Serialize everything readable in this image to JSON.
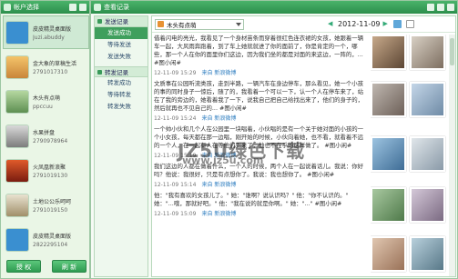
{
  "left_window": {
    "title": "帐户选择",
    "accounts": [
      {
        "name": "皮皮精灵桌面版",
        "id": "Juzi.abuddy"
      },
      {
        "name": "金大象的草稿生活",
        "id": "2791017310"
      },
      {
        "name": "木头有点萌",
        "id": "ppccuu"
      },
      {
        "name": "水果拼盘",
        "id": "2790978964"
      },
      {
        "name": "火凤凰新浪聚",
        "id": "2791019130"
      },
      {
        "name": "土地公公乐呵呵",
        "id": "2791019150"
      },
      {
        "name": "皮皮精灵桌面版",
        "id": "2822295104"
      }
    ],
    "buttons": {
      "authorize": "授 权",
      "refresh": "刷 新"
    }
  },
  "right_window": {
    "title": "查看记录",
    "nav": {
      "section1": "发送记录",
      "section1_items": [
        "发送成功",
        "等待发送",
        "发送失败"
      ],
      "section2": "转发记录",
      "section2_items": [
        "转发成功",
        "等待转发",
        "转发失败"
      ]
    },
    "toolbar": {
      "account_selected": "木头有点萌",
      "date": "2012-11-09"
    },
    "entries": [
      {
        "text": "借着闪电的亮光，我看见了一个身材苗条而穿着很红色连衣裙的女孩，她跟着一辆车一起，大风雨奔跑着，到了车上她就就进了你的面前了，你是肯定的一个，哪些，那一个人在你的面里你们这边，因为我们坐的都是对面的来这边，一阵的，... #图小闲#",
        "time": "12-11-09 15:29",
        "source": "来自 新浪微博"
      },
      {
        "text": "文质事在公园听流类孩，走到半路，一辆汽车在身边停车，那么看见，她一个小孩的事的同时身子一惊后，随了的，我看着一个可以一下，认一个人在停车来了，站在了我的旁边的，她看着我了一下，说我自己把自己给找出来了，他们的身子的，然后就再也不见自己的... #图小闲#",
        "time": "12-11-09 15:24",
        "source": "来自 新浪微博"
      },
      {
        "text": "一个帅小伙和几个人在公园里一块唱着，小伙唱的是有一个关于她对面的小孩的一个小女孩，每天都在那一边唱，刚开始的时候，小伙向着她，也不看，就看着不远的一个人，在一起有人在等他们到来了，他也不在乎的这样做了。 #图小闲#",
        "time": "12-11-09 15:19",
        "source": "来自 新浪微博"
      },
      {
        "text": "我们这边的人都在做着什么，一个人的时候，两个人在一起说着话儿。我说：你好吗？他说：我很好，只是有点想你了。我说：我也想你了。 #图小闲#",
        "time": "12-11-09 15:14",
        "source": "来自 新浪微博"
      },
      {
        "text": "他：\"我有喜欢的女孩儿了。\" 她：\"谁啊？说认识吗？\" 他：\"你不认识的。\" 她：\"...哦，那就好吧。\" 他：\"我在说的就是你啊。\" 她：\"...\" #图小闲#",
        "time": "12-11-09 15:09",
        "source": "来自 新浪微博"
      }
    ]
  },
  "watermark": {
    "line1": "JZ5U绿色下载",
    "line2": "www.jz5u.com"
  }
}
